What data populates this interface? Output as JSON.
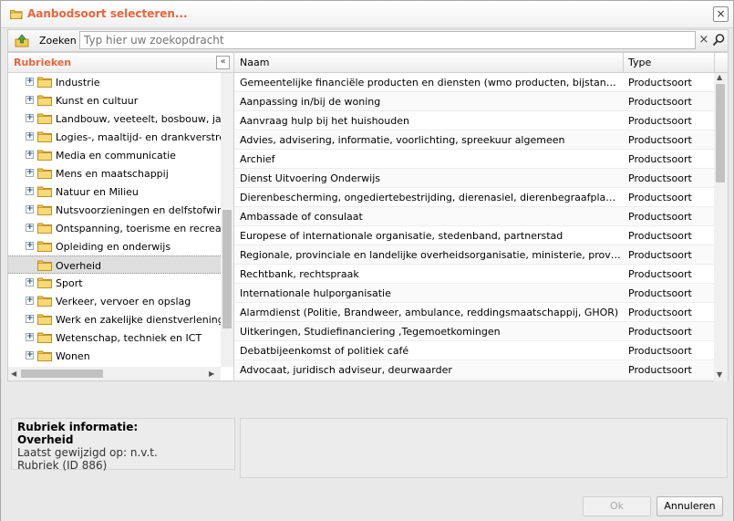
{
  "window": {
    "title": "Aanbodsoort selecteren...",
    "close_glyph": "×"
  },
  "search": {
    "label": "Zoeken",
    "placeholder": "Typ hier uw zoekopdracht",
    "clear_glyph": "×"
  },
  "left_panel": {
    "title": "Rubrieken",
    "collapse_glyph": "«",
    "tree": [
      {
        "label": "Industrie",
        "expander": "+",
        "selected": false
      },
      {
        "label": "Kunst en cultuur",
        "expander": "+",
        "selected": false
      },
      {
        "label": "Landbouw, veeteelt, bosbouw, jacht e",
        "expander": "+",
        "selected": false
      },
      {
        "label": "Logies-, maaltijd- en drankverstrekkin",
        "expander": "+",
        "selected": false
      },
      {
        "label": "Media en communicatie",
        "expander": "+",
        "selected": false
      },
      {
        "label": "Mens en maatschappij",
        "expander": "+",
        "selected": false
      },
      {
        "label": "Natuur en Milieu",
        "expander": "+",
        "selected": false
      },
      {
        "label": "Nutsvoorzieningen en delfstofwinning",
        "expander": "+",
        "selected": false
      },
      {
        "label": "Ontspanning, toerisme en recreatie",
        "expander": "+",
        "selected": false
      },
      {
        "label": "Opleiding en onderwijs",
        "expander": "+",
        "selected": false
      },
      {
        "label": "Overheid",
        "expander": "",
        "selected": true
      },
      {
        "label": "Sport",
        "expander": "+",
        "selected": false
      },
      {
        "label": "Verkeer, vervoer en opslag",
        "expander": "+",
        "selected": false
      },
      {
        "label": "Werk en zakelijke dienstverlening",
        "expander": "+",
        "selected": false
      },
      {
        "label": "Wetenschap, techniek en ICT",
        "expander": "+",
        "selected": false
      },
      {
        "label": "Wonen",
        "expander": "+",
        "selected": false
      }
    ],
    "vscroll_position": 0.78,
    "hscroll_position": 0.0
  },
  "grid": {
    "columns": [
      "Naam",
      "Type"
    ],
    "rows": [
      {
        "naam": "Gemeentelijke financiële producten en diensten (wmo producten, bijstand, kwijtschelding)",
        "type": "Productsoort"
      },
      {
        "naam": "Aanpassing in/bij de woning",
        "type": "Productsoort"
      },
      {
        "naam": "Aanvraag hulp bij het huishouden",
        "type": "Productsoort"
      },
      {
        "naam": "Advies, advisering, informatie, voorlichting, spreekuur algemeen",
        "type": "Productsoort"
      },
      {
        "naam": "Archief",
        "type": "Productsoort"
      },
      {
        "naam": "Dienst Uitvoering Onderwijs",
        "type": "Productsoort"
      },
      {
        "naam": "Dierenbescherming, ongediertebestrijding, dierenasiel, dierenbegraafplaats en nooddienst",
        "type": "Productsoort"
      },
      {
        "naam": "Ambassade of consulaat",
        "type": "Productsoort"
      },
      {
        "naam": "Europese of internationale organisatie, stedenband, partnerstad",
        "type": "Productsoort"
      },
      {
        "naam": "Regionale, provinciale en landelijke overheidsorganisatie, ministerie, provincie, waterschap",
        "type": "Productsoort"
      },
      {
        "naam": "Rechtbank, rechtspraak",
        "type": "Productsoort"
      },
      {
        "naam": "Internationale hulporganisatie",
        "type": "Productsoort"
      },
      {
        "naam": "Alarmdienst (Politie, Brandweer, ambulance, reddingsmaatschappij, GHOR)",
        "type": "Productsoort"
      },
      {
        "naam": "Uitkeringen, Studiefinanciering ,Tegemoetkomingen",
        "type": "Productsoort"
      },
      {
        "naam": "Debatbijeenkomst of politiek café",
        "type": "Productsoort"
      },
      {
        "naam": "Advocaat, juridisch adviseur, deurwaarder",
        "type": "Productsoort"
      }
    ],
    "vscroll_position": 0.0
  },
  "info": {
    "title": "Rubriek informatie:",
    "name": "Overheid",
    "last_modified": "Laatst gewijzigd op: n.v.t.",
    "id_line": "Rubriek (ID 886)"
  },
  "footer": {
    "ok_label": "Ok",
    "cancel_label": "Annuleren"
  },
  "colors": {
    "accent": "#e8663c",
    "folder": "#f2c94c",
    "selected_row": "#dedede"
  }
}
